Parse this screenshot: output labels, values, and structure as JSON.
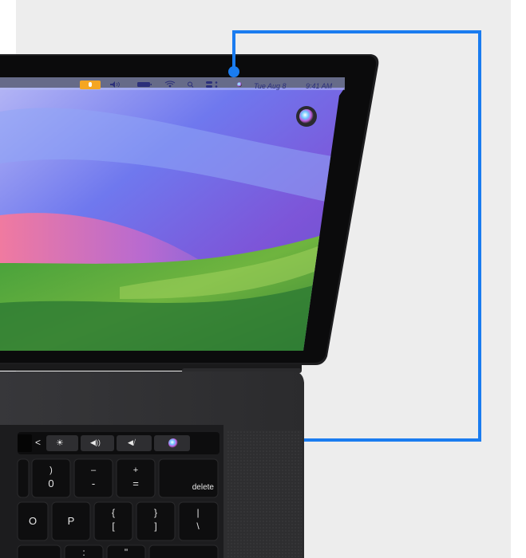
{
  "menubar": {
    "date": "Tue Aug 8",
    "time": "9:41 AM"
  },
  "touchbar": {
    "back": "<",
    "brightness": "☀",
    "volume": "◀))",
    "mute": "◀⧸"
  },
  "keys": {
    "paren": ")",
    "zero": "0",
    "dash": "–",
    "minus": "-",
    "plus": "+",
    "equals": "=",
    "delete": "delete",
    "o": "O",
    "p": "P",
    "brace_open": "{",
    "bracket_open": "[",
    "brace_close": "}",
    "bracket_close": "]",
    "pipe": "|",
    "backslash": "\\",
    "colon": ":",
    "quote": "\""
  },
  "colors": {
    "callout_line": "#1a7cf0",
    "background": "#ededed",
    "laptop_body": "#2c2c2e"
  },
  "icons": [
    "microphone-icon",
    "volume-icon",
    "battery-icon",
    "wifi-icon",
    "search-icon",
    "control-center-icon",
    "siri-icon"
  ]
}
